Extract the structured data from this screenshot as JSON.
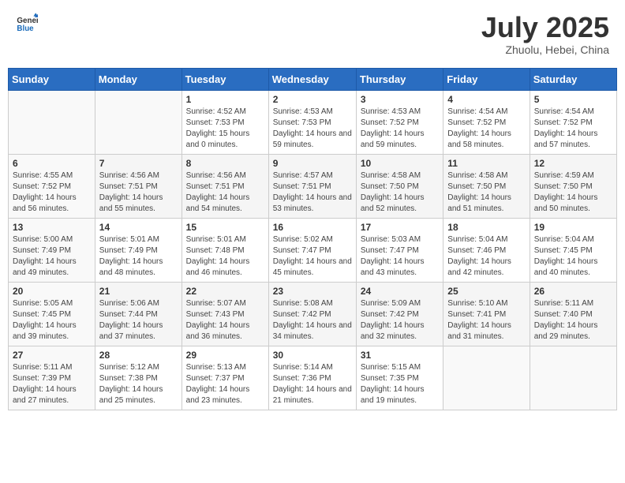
{
  "header": {
    "logo_general": "General",
    "logo_blue": "Blue",
    "month": "July 2025",
    "location": "Zhuolu, Hebei, China"
  },
  "weekdays": [
    "Sunday",
    "Monday",
    "Tuesday",
    "Wednesday",
    "Thursday",
    "Friday",
    "Saturday"
  ],
  "weeks": [
    [
      {
        "day": "",
        "sunrise": "",
        "sunset": "",
        "daylight": ""
      },
      {
        "day": "",
        "sunrise": "",
        "sunset": "",
        "daylight": ""
      },
      {
        "day": "1",
        "sunrise": "Sunrise: 4:52 AM",
        "sunset": "Sunset: 7:53 PM",
        "daylight": "Daylight: 15 hours and 0 minutes."
      },
      {
        "day": "2",
        "sunrise": "Sunrise: 4:53 AM",
        "sunset": "Sunset: 7:53 PM",
        "daylight": "Daylight: 14 hours and 59 minutes."
      },
      {
        "day": "3",
        "sunrise": "Sunrise: 4:53 AM",
        "sunset": "Sunset: 7:52 PM",
        "daylight": "Daylight: 14 hours and 59 minutes."
      },
      {
        "day": "4",
        "sunrise": "Sunrise: 4:54 AM",
        "sunset": "Sunset: 7:52 PM",
        "daylight": "Daylight: 14 hours and 58 minutes."
      },
      {
        "day": "5",
        "sunrise": "Sunrise: 4:54 AM",
        "sunset": "Sunset: 7:52 PM",
        "daylight": "Daylight: 14 hours and 57 minutes."
      }
    ],
    [
      {
        "day": "6",
        "sunrise": "Sunrise: 4:55 AM",
        "sunset": "Sunset: 7:52 PM",
        "daylight": "Daylight: 14 hours and 56 minutes."
      },
      {
        "day": "7",
        "sunrise": "Sunrise: 4:56 AM",
        "sunset": "Sunset: 7:51 PM",
        "daylight": "Daylight: 14 hours and 55 minutes."
      },
      {
        "day": "8",
        "sunrise": "Sunrise: 4:56 AM",
        "sunset": "Sunset: 7:51 PM",
        "daylight": "Daylight: 14 hours and 54 minutes."
      },
      {
        "day": "9",
        "sunrise": "Sunrise: 4:57 AM",
        "sunset": "Sunset: 7:51 PM",
        "daylight": "Daylight: 14 hours and 53 minutes."
      },
      {
        "day": "10",
        "sunrise": "Sunrise: 4:58 AM",
        "sunset": "Sunset: 7:50 PM",
        "daylight": "Daylight: 14 hours and 52 minutes."
      },
      {
        "day": "11",
        "sunrise": "Sunrise: 4:58 AM",
        "sunset": "Sunset: 7:50 PM",
        "daylight": "Daylight: 14 hours and 51 minutes."
      },
      {
        "day": "12",
        "sunrise": "Sunrise: 4:59 AM",
        "sunset": "Sunset: 7:50 PM",
        "daylight": "Daylight: 14 hours and 50 minutes."
      }
    ],
    [
      {
        "day": "13",
        "sunrise": "Sunrise: 5:00 AM",
        "sunset": "Sunset: 7:49 PM",
        "daylight": "Daylight: 14 hours and 49 minutes."
      },
      {
        "day": "14",
        "sunrise": "Sunrise: 5:01 AM",
        "sunset": "Sunset: 7:49 PM",
        "daylight": "Daylight: 14 hours and 48 minutes."
      },
      {
        "day": "15",
        "sunrise": "Sunrise: 5:01 AM",
        "sunset": "Sunset: 7:48 PM",
        "daylight": "Daylight: 14 hours and 46 minutes."
      },
      {
        "day": "16",
        "sunrise": "Sunrise: 5:02 AM",
        "sunset": "Sunset: 7:47 PM",
        "daylight": "Daylight: 14 hours and 45 minutes."
      },
      {
        "day": "17",
        "sunrise": "Sunrise: 5:03 AM",
        "sunset": "Sunset: 7:47 PM",
        "daylight": "Daylight: 14 hours and 43 minutes."
      },
      {
        "day": "18",
        "sunrise": "Sunrise: 5:04 AM",
        "sunset": "Sunset: 7:46 PM",
        "daylight": "Daylight: 14 hours and 42 minutes."
      },
      {
        "day": "19",
        "sunrise": "Sunrise: 5:04 AM",
        "sunset": "Sunset: 7:45 PM",
        "daylight": "Daylight: 14 hours and 40 minutes."
      }
    ],
    [
      {
        "day": "20",
        "sunrise": "Sunrise: 5:05 AM",
        "sunset": "Sunset: 7:45 PM",
        "daylight": "Daylight: 14 hours and 39 minutes."
      },
      {
        "day": "21",
        "sunrise": "Sunrise: 5:06 AM",
        "sunset": "Sunset: 7:44 PM",
        "daylight": "Daylight: 14 hours and 37 minutes."
      },
      {
        "day": "22",
        "sunrise": "Sunrise: 5:07 AM",
        "sunset": "Sunset: 7:43 PM",
        "daylight": "Daylight: 14 hours and 36 minutes."
      },
      {
        "day": "23",
        "sunrise": "Sunrise: 5:08 AM",
        "sunset": "Sunset: 7:42 PM",
        "daylight": "Daylight: 14 hours and 34 minutes."
      },
      {
        "day": "24",
        "sunrise": "Sunrise: 5:09 AM",
        "sunset": "Sunset: 7:42 PM",
        "daylight": "Daylight: 14 hours and 32 minutes."
      },
      {
        "day": "25",
        "sunrise": "Sunrise: 5:10 AM",
        "sunset": "Sunset: 7:41 PM",
        "daylight": "Daylight: 14 hours and 31 minutes."
      },
      {
        "day": "26",
        "sunrise": "Sunrise: 5:11 AM",
        "sunset": "Sunset: 7:40 PM",
        "daylight": "Daylight: 14 hours and 29 minutes."
      }
    ],
    [
      {
        "day": "27",
        "sunrise": "Sunrise: 5:11 AM",
        "sunset": "Sunset: 7:39 PM",
        "daylight": "Daylight: 14 hours and 27 minutes."
      },
      {
        "day": "28",
        "sunrise": "Sunrise: 5:12 AM",
        "sunset": "Sunset: 7:38 PM",
        "daylight": "Daylight: 14 hours and 25 minutes."
      },
      {
        "day": "29",
        "sunrise": "Sunrise: 5:13 AM",
        "sunset": "Sunset: 7:37 PM",
        "daylight": "Daylight: 14 hours and 23 minutes."
      },
      {
        "day": "30",
        "sunrise": "Sunrise: 5:14 AM",
        "sunset": "Sunset: 7:36 PM",
        "daylight": "Daylight: 14 hours and 21 minutes."
      },
      {
        "day": "31",
        "sunrise": "Sunrise: 5:15 AM",
        "sunset": "Sunset: 7:35 PM",
        "daylight": "Daylight: 14 hours and 19 minutes."
      },
      {
        "day": "",
        "sunrise": "",
        "sunset": "",
        "daylight": ""
      },
      {
        "day": "",
        "sunrise": "",
        "sunset": "",
        "daylight": ""
      }
    ]
  ]
}
